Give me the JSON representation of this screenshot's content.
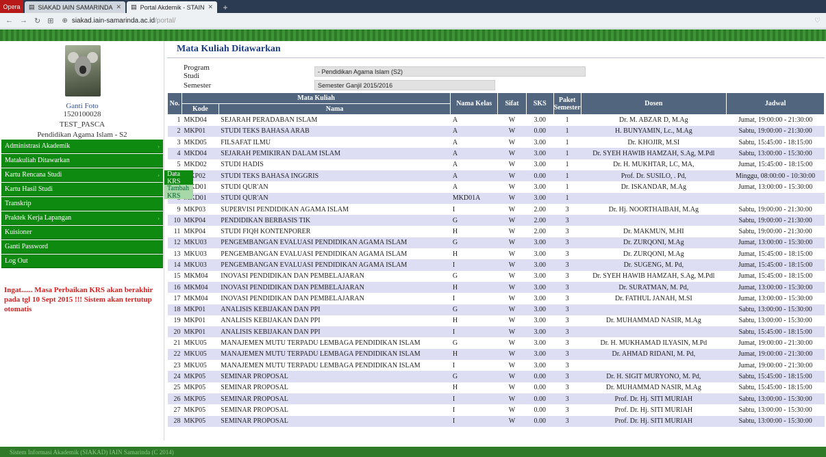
{
  "browser": {
    "brand": "Opera",
    "tabs": [
      {
        "label": "SIAKAD IAIN SAMARINDA",
        "active": false
      },
      {
        "label": "Portal Akdemik - STAIN",
        "active": true
      }
    ],
    "new_tab": "+",
    "url_host": "siakad.iain-samarinda.ac.id",
    "url_path": "/portal/"
  },
  "profile": {
    "photo_label": "Ganti Foto",
    "nim": "1520100028",
    "name": "TEST_PASCA",
    "program": "Pendidikan Agama Islam - S2"
  },
  "menu": [
    {
      "label": "Administrasi Akademik",
      "has_submenu": true
    },
    {
      "label": "Matakuliah Ditawarkan",
      "has_submenu": false
    },
    {
      "label": "Kartu Rencana Studi",
      "has_submenu": true
    },
    {
      "label": "Kartu Hasil Studi",
      "has_submenu": false
    },
    {
      "label": "Transkrip",
      "has_submenu": false
    },
    {
      "label": "Praktek Kerja Lapangan",
      "has_submenu": true
    },
    {
      "label": "Kuisioner",
      "has_submenu": false
    },
    {
      "label": "Ganti Password",
      "has_submenu": false
    },
    {
      "label": "Log Out",
      "has_submenu": false
    }
  ],
  "submenu": [
    "Data KRS",
    "Tambah KRS"
  ],
  "notice": "Ingat...... Masa Perbaikan KRS akan berakhir pada tgl 10 Sept 2015 !!! Sistem akan tertutup otomatis",
  "page": {
    "title": "Mata Kuliah Ditawarkan",
    "program_label": "Program Studi",
    "program_value": "- Pendidikan Agama Islam (S2)",
    "semester_label": "Semester",
    "semester_value": "Semester Ganjil 2015/2016"
  },
  "table": {
    "headers": {
      "no": "No.",
      "mata_kuliah": "Mata Kuliah",
      "kode": "Kode",
      "nama": "Nama",
      "kelas": "Nama Kelas",
      "sifat": "Sifat",
      "sks": "SKS",
      "paket": "Paket Semester",
      "dosen": "Dosen",
      "jadwal": "Jadwal"
    },
    "rows": [
      {
        "no": "1",
        "kode": "MKD04",
        "nama": "SEJARAH PERADABAN ISLAM",
        "kelas": "A",
        "sifat": "W",
        "sks": "3.00",
        "paket": "1",
        "dosen": "Dr. M. ABZAR D, M.Ag",
        "jadwal": "Jumat, 19:00:00 - 21:30:00"
      },
      {
        "no": "2",
        "kode": "MKP01",
        "nama": "STUDI TEKS BAHASA ARAB",
        "kelas": "A",
        "sifat": "W",
        "sks": "0.00",
        "paket": "1",
        "dosen": "H. BUNYAMIN, Lc., M.Ag",
        "jadwal": "Sabtu, 19:00:00 - 21:30:00"
      },
      {
        "no": "3",
        "kode": "MKD05",
        "nama": "FILSAFAT ILMU",
        "kelas": "A",
        "sifat": "W",
        "sks": "3.00",
        "paket": "1",
        "dosen": "Dr. KHOJIR, M.SI",
        "jadwal": "Sabtu, 15:45:00 - 18:15:00"
      },
      {
        "no": "4",
        "kode": "MKD04",
        "nama": "SEJARAH PEMIKIRAN DALAM ISLAM",
        "kelas": "A",
        "sifat": "W",
        "sks": "3.00",
        "paket": "1",
        "dosen": "Dr. SYEH HAWIB HAMZAH, S.Ag, M.Pdl",
        "jadwal": "Sabtu, 13:00:00 - 15:30:00"
      },
      {
        "no": "5",
        "kode": "MKD02",
        "nama": "STUDI HADIS",
        "kelas": "A",
        "sifat": "W",
        "sks": "3.00",
        "paket": "1",
        "dosen": "Dr. H. MUKHTAR, LC, MA,",
        "jadwal": "Jumat, 15:45:00 - 18:15:00"
      },
      {
        "no": "6",
        "kode": "MKP02",
        "nama": "STUDI TEKS BAHASA INGGRIS",
        "kelas": "A",
        "sifat": "W",
        "sks": "0.00",
        "paket": "1",
        "dosen": "Prof. Dr. SUSILO, . Pd,",
        "jadwal": "Minggu, 08:00:00 - 10:30:00"
      },
      {
        "no": "7",
        "kode": "MKD01",
        "nama": "STUDI QUR'AN",
        "kelas": "A",
        "sifat": "W",
        "sks": "3.00",
        "paket": "1",
        "dosen": "Dr. ISKANDAR, M.Ag",
        "jadwal": "Jumat, 13:00:00 - 15:30:00"
      },
      {
        "no": "8",
        "kode": "MKD01",
        "nama": "STUDI QUR'AN",
        "kelas": "MKD01A",
        "sifat": "W",
        "sks": "3.00",
        "paket": "1",
        "dosen": "",
        "jadwal": ""
      },
      {
        "no": "9",
        "kode": "MKP03",
        "nama": "SUPERVISI PENDIDIKAN AGAMA ISLAM",
        "kelas": "I",
        "sifat": "W",
        "sks": "2.00",
        "paket": "3",
        "dosen": "Dr. Hj. NOORTHAIBAH, M.Ag",
        "jadwal": "Sabtu, 19:00:00 - 21:30:00"
      },
      {
        "no": "10",
        "kode": "MKP04",
        "nama": "PENDIDIKAN BERBASIS TIK",
        "kelas": "G",
        "sifat": "W",
        "sks": "2.00",
        "paket": "3",
        "dosen": "",
        "jadwal": "Sabtu, 19:00:00 - 21:30:00"
      },
      {
        "no": "11",
        "kode": "MKP04",
        "nama": "STUDI FIQH KONTENPORER",
        "kelas": "H",
        "sifat": "W",
        "sks": "2.00",
        "paket": "3",
        "dosen": "Dr. MAKMUN, M.HI",
        "jadwal": "Sabtu, 19:00:00 - 21:30:00"
      },
      {
        "no": "12",
        "kode": "MKU03",
        "nama": "PENGEMBANGAN EVALUASI PENDIDIKAN AGAMA ISLAM",
        "kelas": "G",
        "sifat": "W",
        "sks": "3.00",
        "paket": "3",
        "dosen": "Dr. ZURQONI, M.Ag",
        "jadwal": "Jumat, 13:00:00 - 15:30:00"
      },
      {
        "no": "13",
        "kode": "MKU03",
        "nama": "PENGEMBANGAN EVALUASI PENDIDIKAN AGAMA ISLAM",
        "kelas": "H",
        "sifat": "W",
        "sks": "3.00",
        "paket": "3",
        "dosen": "Dr. ZURQONI, M.Ag",
        "jadwal": "Jumat, 15:45:00 - 18:15:00"
      },
      {
        "no": "14",
        "kode": "MKU03",
        "nama": "PENGEMBANGAN EVALUASI PENDIDIKAN AGAMA ISLAM",
        "kelas": "I",
        "sifat": "W",
        "sks": "3.00",
        "paket": "3",
        "dosen": "Dr. SUGENG, M. Pd,",
        "jadwal": "Jumat, 15:45:00 - 18:15:00"
      },
      {
        "no": "15",
        "kode": "MKM04",
        "nama": "INOVASI PENDIDIKAN DAN PEMBELAJARAN",
        "kelas": "G",
        "sifat": "W",
        "sks": "3.00",
        "paket": "3",
        "dosen": "Dr. SYEH HAWIB HAMZAH, S.Ag, M.Pdl",
        "jadwal": "Jumat, 15:45:00 - 18:15:00"
      },
      {
        "no": "16",
        "kode": "MKM04",
        "nama": "INOVASI PENDIDIKAN DAN PEMBELAJARAN",
        "kelas": "H",
        "sifat": "W",
        "sks": "3.00",
        "paket": "3",
        "dosen": "Dr. SURATMAN, M. Pd,",
        "jadwal": "Jumat, 13:00:00 - 15:30:00"
      },
      {
        "no": "17",
        "kode": "MKM04",
        "nama": "INOVASI PENDIDIKAN DAN PEMBELAJARAN",
        "kelas": "I",
        "sifat": "W",
        "sks": "3.00",
        "paket": "3",
        "dosen": "Dr. FATHUL JANAH, M.SI",
        "jadwal": "Jumat, 13:00:00 - 15:30:00"
      },
      {
        "no": "18",
        "kode": "MKP01",
        "nama": "ANALISIS KEBIJAKAN DAN PPI",
        "kelas": "G",
        "sifat": "W",
        "sks": "3.00",
        "paket": "3",
        "dosen": "",
        "jadwal": "Sabtu, 13:00:00 - 15:30:00"
      },
      {
        "no": "19",
        "kode": "MKP01",
        "nama": "ANALISIS KEBIJAKAN DAN PPI",
        "kelas": "H",
        "sifat": "W",
        "sks": "3.00",
        "paket": "3",
        "dosen": "Dr. MUHAMMAD NASIR, M.Ag",
        "jadwal": "Sabtu, 13:00:00 - 15:30:00"
      },
      {
        "no": "20",
        "kode": "MKP01",
        "nama": "ANALISIS KEBIJAKAN DAN PPI",
        "kelas": "I",
        "sifat": "W",
        "sks": "3.00",
        "paket": "3",
        "dosen": "",
        "jadwal": "Sabtu, 15:45:00 - 18:15:00"
      },
      {
        "no": "21",
        "kode": "MKU05",
        "nama": "MANAJEMEN MUTU TERPADU LEMBAGA PENDIDIKAN ISLAM",
        "kelas": "G",
        "sifat": "W",
        "sks": "3.00",
        "paket": "3",
        "dosen": "Dr. H. MUKHAMAD ILYASIN, M.Pd",
        "jadwal": "Jumat, 19:00:00 - 21:30:00"
      },
      {
        "no": "22",
        "kode": "MKU05",
        "nama": "MANAJEMEN MUTU TERPADU LEMBAGA PENDIDIKAN ISLAM",
        "kelas": "H",
        "sifat": "W",
        "sks": "3.00",
        "paket": "3",
        "dosen": "Dr. AHMAD RIDANI, M. Pd,",
        "jadwal": "Jumat, 19:00:00 - 21:30:00"
      },
      {
        "no": "23",
        "kode": "MKU05",
        "nama": "MANAJEMEN MUTU TERPADU LEMBAGA PENDIDIKAN ISLAM",
        "kelas": "I",
        "sifat": "W",
        "sks": "3.00",
        "paket": "3",
        "dosen": "",
        "jadwal": "Jumat, 19:00:00 - 21:30:00"
      },
      {
        "no": "24",
        "kode": "MKP05",
        "nama": "SEMINAR PROPOSAL",
        "kelas": "G",
        "sifat": "W",
        "sks": "0.00",
        "paket": "3",
        "dosen": "Dr. H. SIGIT MURYONO, M. Pd,",
        "jadwal": "Sabtu, 15:45:00 - 18:15:00"
      },
      {
        "no": "25",
        "kode": "MKP05",
        "nama": "SEMINAR PROPOSAL",
        "kelas": "H",
        "sifat": "W",
        "sks": "0.00",
        "paket": "3",
        "dosen": "Dr. MUHAMMAD NASIR, M.Ag",
        "jadwal": "Sabtu, 15:45:00 - 18:15:00"
      },
      {
        "no": "26",
        "kode": "MKP05",
        "nama": "SEMINAR PROPOSAL",
        "kelas": "I",
        "sifat": "W",
        "sks": "0.00",
        "paket": "3",
        "dosen": "Prof. Dr. Hj. SITI MURIAH",
        "jadwal": "Sabtu, 13:00:00 - 15:30:00"
      },
      {
        "no": "27",
        "kode": "MKP05",
        "nama": "SEMINAR PROPOSAL",
        "kelas": "I",
        "sifat": "W",
        "sks": "0.00",
        "paket": "3",
        "dosen": "Prof. Dr. Hj. SITI MURIAH",
        "jadwal": "Sabtu, 13:00:00 - 15:30:00"
      },
      {
        "no": "28",
        "kode": "MKP05",
        "nama": "SEMINAR PROPOSAL",
        "kelas": "I",
        "sifat": "W",
        "sks": "0.00",
        "paket": "3",
        "dosen": "Prof. Dr. Hj. SITI MURIAH",
        "jadwal": "Sabtu, 13:00:00 - 15:30:00"
      }
    ]
  },
  "footer": "Sistem Informasi Akademik (SIAKAD) IAIN Samarinda (C 2014)",
  "colors": {
    "menu_green": "#0f8a10",
    "header_slate": "#51667e",
    "row_alt": "#ddddf3",
    "notice_red": "#d22222"
  }
}
